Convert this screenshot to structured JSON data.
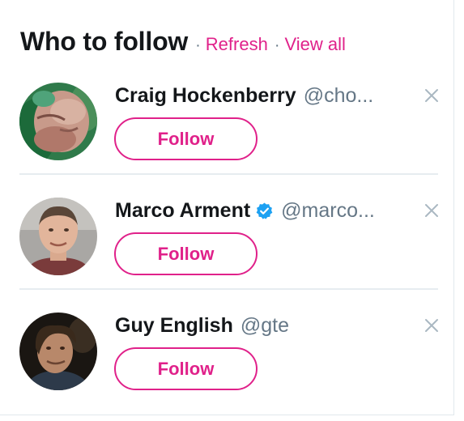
{
  "header": {
    "title": "Who to follow",
    "separator": "·",
    "refresh_label": "Refresh",
    "view_all_label": "View all"
  },
  "accounts": [
    {
      "name": "Craig Hockenberry",
      "handle": "@cho...",
      "verified": false,
      "follow_label": "Follow",
      "avatar_icon": "user-avatar"
    },
    {
      "name": "Marco Arment",
      "handle": "@marco...",
      "verified": true,
      "follow_label": "Follow",
      "avatar_icon": "user-avatar"
    },
    {
      "name": "Guy English",
      "handle": "@gte",
      "verified": false,
      "follow_label": "Follow",
      "avatar_icon": "user-avatar"
    }
  ],
  "icons": {
    "dismiss": "close-icon",
    "verified": "verified-badge-icon"
  },
  "colors": {
    "accent": "#e0218a",
    "verified": "#1da1f2",
    "text_primary": "#14171a",
    "text_secondary": "#657786",
    "divider": "#e6ecf0",
    "close_icon": "#aab8c2"
  }
}
